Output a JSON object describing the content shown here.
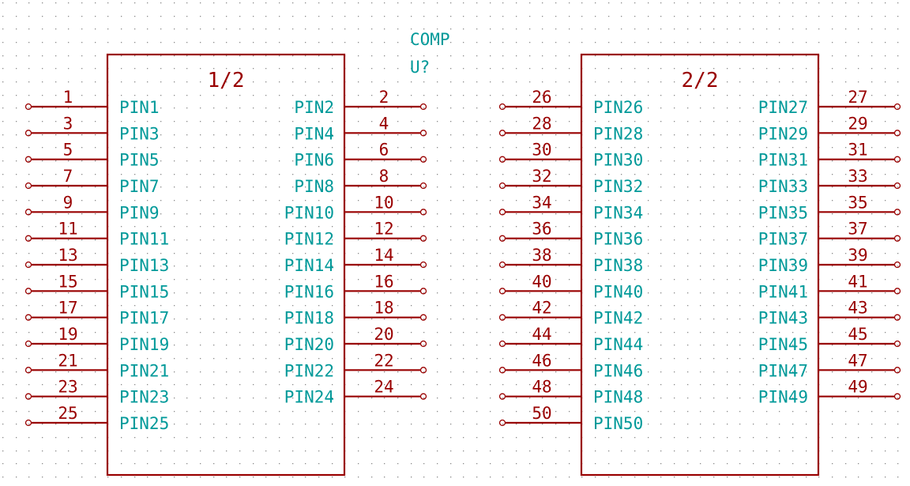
{
  "canvas": {
    "background": "#ffffff",
    "grid_color": "#8a8a8a",
    "body_color": "#990000",
    "pin_name_color": "#009999",
    "field_color": "#009999"
  },
  "component": {
    "value": "COMP",
    "reference": "U?",
    "units": [
      {
        "label": "1/2",
        "left_pins": [
          {
            "num": "1",
            "name": "PIN1"
          },
          {
            "num": "3",
            "name": "PIN3"
          },
          {
            "num": "5",
            "name": "PIN5"
          },
          {
            "num": "7",
            "name": "PIN7"
          },
          {
            "num": "9",
            "name": "PIN9"
          },
          {
            "num": "11",
            "name": "PIN11"
          },
          {
            "num": "13",
            "name": "PIN13"
          },
          {
            "num": "15",
            "name": "PIN15"
          },
          {
            "num": "17",
            "name": "PIN17"
          },
          {
            "num": "19",
            "name": "PIN19"
          },
          {
            "num": "21",
            "name": "PIN21"
          },
          {
            "num": "23",
            "name": "PIN23"
          },
          {
            "num": "25",
            "name": "PIN25"
          }
        ],
        "right_pins": [
          {
            "num": "2",
            "name": "PIN2"
          },
          {
            "num": "4",
            "name": "PIN4"
          },
          {
            "num": "6",
            "name": "PIN6"
          },
          {
            "num": "8",
            "name": "PIN8"
          },
          {
            "num": "10",
            "name": "PIN10"
          },
          {
            "num": "12",
            "name": "PIN12"
          },
          {
            "num": "14",
            "name": "PIN14"
          },
          {
            "num": "16",
            "name": "PIN16"
          },
          {
            "num": "18",
            "name": "PIN18"
          },
          {
            "num": "20",
            "name": "PIN20"
          },
          {
            "num": "22",
            "name": "PIN22"
          },
          {
            "num": "24",
            "name": "PIN24"
          }
        ]
      },
      {
        "label": "2/2",
        "left_pins": [
          {
            "num": "26",
            "name": "PIN26"
          },
          {
            "num": "28",
            "name": "PIN28"
          },
          {
            "num": "30",
            "name": "PIN30"
          },
          {
            "num": "32",
            "name": "PIN32"
          },
          {
            "num": "34",
            "name": "PIN34"
          },
          {
            "num": "36",
            "name": "PIN36"
          },
          {
            "num": "38",
            "name": "PIN38"
          },
          {
            "num": "40",
            "name": "PIN40"
          },
          {
            "num": "42",
            "name": "PIN42"
          },
          {
            "num": "44",
            "name": "PIN44"
          },
          {
            "num": "46",
            "name": "PIN46"
          },
          {
            "num": "48",
            "name": "PIN48"
          },
          {
            "num": "50",
            "name": "PIN50"
          }
        ],
        "right_pins": [
          {
            "num": "27",
            "name": "PIN27"
          },
          {
            "num": "29",
            "name": "PIN29"
          },
          {
            "num": "31",
            "name": "PIN31"
          },
          {
            "num": "33",
            "name": "PIN33"
          },
          {
            "num": "35",
            "name": "PIN35"
          },
          {
            "num": "37",
            "name": "PIN37"
          },
          {
            "num": "39",
            "name": "PIN39"
          },
          {
            "num": "41",
            "name": "PIN41"
          },
          {
            "num": "43",
            "name": "PIN43"
          },
          {
            "num": "45",
            "name": "PIN45"
          },
          {
            "num": "47",
            "name": "PIN47"
          },
          {
            "num": "49",
            "name": "PIN49"
          }
        ]
      }
    ]
  }
}
